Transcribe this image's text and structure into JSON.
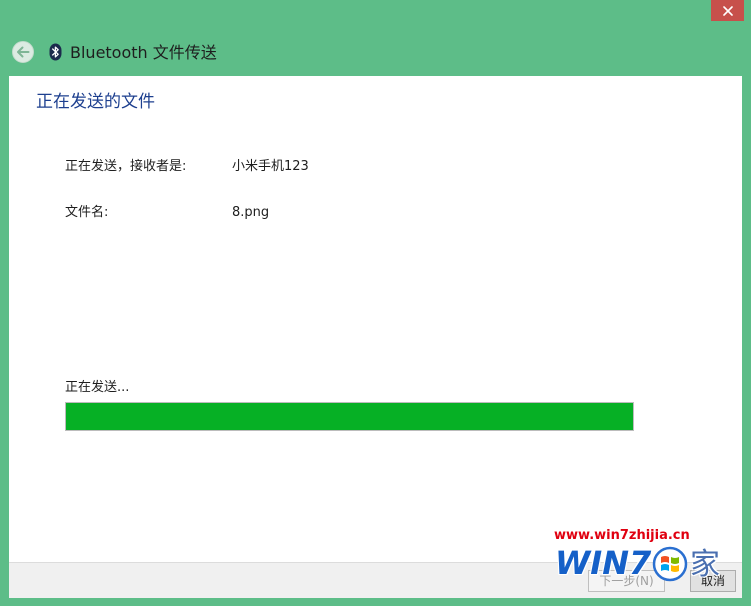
{
  "window": {
    "title": "Bluetooth 文件传送",
    "colors": {
      "frame": "#5dbd88",
      "close": "#c7504b",
      "heading": "#1d3f8f",
      "progress": "#06b025"
    }
  },
  "icons": {
    "back": "back-arrow-icon",
    "bluetooth": "bluetooth-icon",
    "close": "close-icon",
    "watermark_logo": "windows-logo-icon"
  },
  "main": {
    "heading": "正在发送的文件",
    "details": [
      {
        "label": "正在发送，接收者是:",
        "value": "小米手机123"
      },
      {
        "label": "文件名:",
        "value": "8.png"
      }
    ],
    "status": "正在发送...",
    "progress_percent": 100
  },
  "footer": {
    "next_label": "下一步(N)",
    "cancel_label": "取消"
  },
  "watermark": {
    "url": "www.win7zhijia.cn",
    "logo_text": "WIN7",
    "logo_char": "家"
  }
}
